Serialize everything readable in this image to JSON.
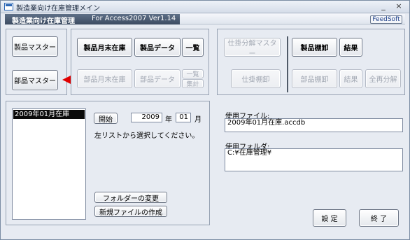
{
  "window": {
    "title": "製造業向け在庫管理メイン",
    "controls": [
      "_",
      "×"
    ]
  },
  "header": {
    "app_name": "製造業向け在庫管理",
    "subtitle": "For Access2007    Ver1.14",
    "feedsoft_label": "FeedSoft"
  },
  "left_panel": {
    "product_master_label": "製品マスター",
    "part_master_label": "部品マスター"
  },
  "middle_panel": {
    "product_month_end_label": "製品月末在庫",
    "product_data_label": "製品データ",
    "product_list_label": "一覧",
    "part_month_end_label": "部品月末在庫",
    "part_data_label": "部品データ",
    "part_list_label": "一覧",
    "part_total_label": "集計"
  },
  "right_panel": {
    "spec_breakdown_master_label": "仕掛分解マスター",
    "spec_inventory_label": "仕掛棚卸",
    "product_stocktake_label": "製品棚卸",
    "product_result_label": "結果",
    "part_stocktake_label": "部品棚卸",
    "part_result_label": "結果",
    "full_breakdown_label": "全再分解"
  },
  "bottom_left": {
    "list_items": [
      "2009年01月在庫"
    ],
    "open_button_label": "開始",
    "year_value": "2009",
    "year_label": "年",
    "month_value": "01",
    "month_label": "月",
    "instruction": "左リストから選択してください。",
    "change_folder_label": "フォルダーの変更",
    "new_file_label": "新規ファイルの作成"
  },
  "bottom_right": {
    "file_label": "使用ファイル:",
    "file_value": "2009年01月在庫.accdb",
    "folder_label": "使用フォルダ:",
    "folder_value": "C:¥在庫管理¥",
    "settings_label": "設  定",
    "exit_label": "終  了"
  },
  "colors": {
    "arrow": "#e00000",
    "header_band": "#3c4b61"
  }
}
